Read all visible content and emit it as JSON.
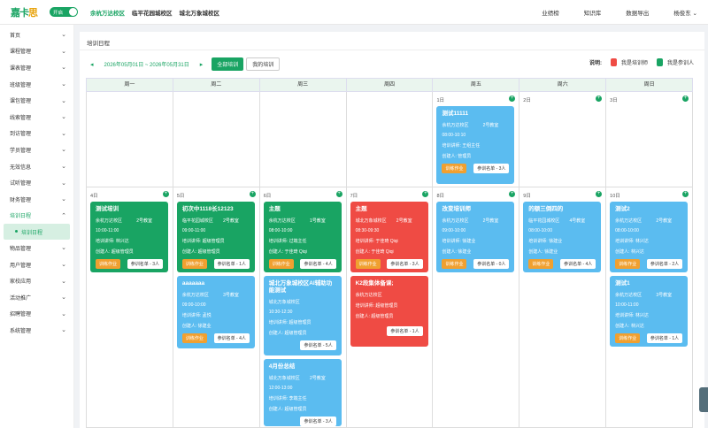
{
  "topbar": {
    "logo_a": "嘉卡",
    "logo_b": "思",
    "toggle_label": "开启",
    "campuses": [
      "余杭万达校区",
      "临平花园城校区",
      "城北万象城校区"
    ],
    "nav": [
      "业绩榜",
      "知识库",
      "数据导出"
    ],
    "user": "杨俊东"
  },
  "sidebar": {
    "items": [
      {
        "label": "首页"
      },
      {
        "label": "课程管理"
      },
      {
        "label": "课表管理"
      },
      {
        "label": "班级管理"
      },
      {
        "label": "课包管理"
      },
      {
        "label": "线索管理"
      },
      {
        "label": "到访管理"
      },
      {
        "label": "学员管理"
      },
      {
        "label": "无效信息"
      },
      {
        "label": "试听管理"
      },
      {
        "label": "财务管理"
      },
      {
        "label": "培训日程"
      }
    ],
    "submenu": "培训日程",
    "items2": [
      {
        "label": "物品管理"
      },
      {
        "label": "用户管理"
      },
      {
        "label": "家校应用"
      },
      {
        "label": "活动推广"
      },
      {
        "label": "招聘管理"
      },
      {
        "label": "系统管理"
      }
    ]
  },
  "main": {
    "title": "培训日程",
    "date_range": "2026年05月01日 ~ 2026年05月31日",
    "btn_all": "全部培训",
    "btn_mine": "我的培训",
    "legend_label": "说明:",
    "legend_trainer": "我是培训师",
    "legend_attendee": "我是参训人",
    "colors": {
      "trainer": "#ef4b44",
      "attendee": "#19a463",
      "other": "#5bbcf0"
    }
  },
  "calendar": {
    "weekdays": [
      "周一",
      "周二",
      "周三",
      "周四",
      "周五",
      "周六",
      "周日"
    ],
    "week1_days": [
      "",
      "",
      "",
      "",
      "1日",
      "2日",
      "3日"
    ],
    "week2_days": [
      "4日",
      "5日",
      "6日",
      "7日",
      "8日",
      "9日",
      "10日"
    ],
    "cards": {
      "c1": {
        "title": "测试11111",
        "campus": "余杭万达校区",
        "room": "2号教室",
        "time": "08:00-10:10",
        "trainer": "培训讲师: 王组主任",
        "creator": "创建人: 管理员",
        "roster": "参训名单 - 3人"
      },
      "c2": {
        "title": "测试培训",
        "campus": "余杭万达校区",
        "room": "2号教室",
        "time": "10:00-11:00",
        "trainer": "培训讲师: 林兴达",
        "creator": "创建人: 超级管理员",
        "hw": "训练作业",
        "roster": "参训名单 - 3人"
      },
      "c3": {
        "title": "初次中1118长12123",
        "campus": "临平花园城校区",
        "room": "2号教室",
        "time": "09:00-11:00",
        "trainer": "培训讲师: 超级管理员",
        "creator": "创建人: 超级管理员",
        "hw": "训练作业",
        "roster": "参训名单 - 1人"
      },
      "c4": {
        "title": "aaaaaaa",
        "campus": "余杭万达校区",
        "room": "3号教室",
        "time": "09:00-10:00",
        "trainer": "培训讲师: 孟悦",
        "creator": "创建人: 徐建业",
        "hw": "训练作业",
        "roster": "参训名单 - 4人"
      },
      "c5": {
        "title": "主题",
        "campus": "余杭万达校区",
        "room": "1号教室",
        "time": "08:00-10:00",
        "trainer": "培训讲师: 过端主任",
        "creator": "创建人: 于佳琦 Qiqi",
        "hw": "训练作业",
        "roster": "参训名单 - 4人"
      },
      "c6": {
        "title": "城北万象城校区AI辅助功能测试",
        "campus": "城北万象城校区",
        "room": "",
        "time": "10:30-12:30",
        "trainer": "培训讲师: 超级管理员",
        "creator": "创建人: 超级管理员",
        "roster": "参训名单 - 5人"
      },
      "c7": {
        "title": "4月份总结",
        "campus": "城北万象城校区",
        "room": "2号教室",
        "time": "12:00-13:00",
        "trainer": "培训讲师: 李端主任",
        "creator": "创建人: 超级管理员",
        "roster": "参训名单 - 3人"
      },
      "c8": {
        "title": "主题",
        "campus": "城北万象城校区",
        "room": "2号教室",
        "time": "08:30-09:30",
        "trainer": "培训讲师: 于佳琦 Qiqi",
        "creator": "创建人: 于佳琦 Qiqi",
        "hw": "训练作业",
        "roster": "参训名单 - 3人"
      },
      "c9": {
        "title": "K2段集体备课;",
        "campus": "余杭万达校区",
        "room": "",
        "time": "",
        "trainer": "培训讲师: 超级管理员",
        "creator": "创建人: 超级管理员",
        "roster": "参训名单 - 1人"
      },
      "c10": {
        "title": "改变培训师",
        "campus": "余杭万达校区",
        "room": "2号教室",
        "time": "09:00-10:00",
        "trainer": "培训讲师: 徐建业",
        "creator": "创建人: 徐建业",
        "hw": "训练作业",
        "roster": "参训名单 - 0人"
      },
      "c11": {
        "title": "的额三倒四的",
        "campus": "临平花园城校区",
        "room": "4号教室",
        "time": "08:00-10:00",
        "trainer": "培训讲师: 徐建业",
        "creator": "创建人: 徐建业",
        "hw": "训练作业",
        "roster": "参训名单 - 4人"
      },
      "c12": {
        "title": "测试2",
        "campus": "余杭万达校区",
        "room": "2号教室",
        "time": "08:00-10:00",
        "trainer": "培训讲师: 林兴达",
        "creator": "创建人: 林兴达",
        "hw": "训练作业",
        "roster": "参训名单 - 2人"
      },
      "c13": {
        "title": "测试1",
        "campus": "余杭万达校区",
        "room": "3号教室",
        "time": "10:00-11:00",
        "trainer": "培训讲师: 林兴达",
        "creator": "创建人: 林兴达",
        "hw": "训练作业",
        "roster": "参训名单 - 1人"
      }
    }
  }
}
